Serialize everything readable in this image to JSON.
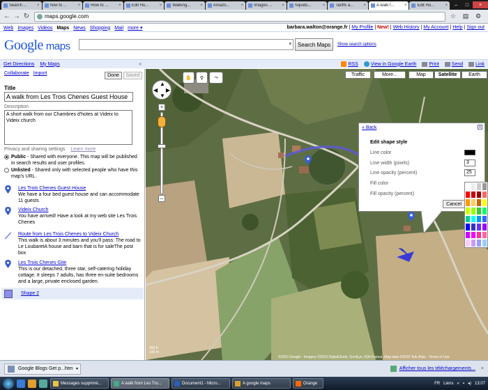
{
  "browser": {
    "tabs": [
      {
        "label": "Search ..."
      },
      {
        "label": "how to ..."
      },
      {
        "label": "How to ..."
      },
      {
        "label": "Edit Hu..."
      },
      {
        "label": "Walking..."
      },
      {
        "label": "Amazo..."
      },
      {
        "label": "Images ..."
      },
      {
        "label": "Squido..."
      },
      {
        "label": "Tariffs a..."
      },
      {
        "label": "A walk f..."
      },
      {
        "label": "Edit Hu..."
      }
    ],
    "url": "maps.google.com"
  },
  "gbar": {
    "links": [
      "Web",
      "Images",
      "Videos",
      "Maps",
      "News",
      "Shopping",
      "Mail",
      "more ▾"
    ],
    "user": "barbara.walton@orange.fr",
    "profile": "My Profile",
    "new_label": "New!",
    "history": "Web History",
    "account": "My Account",
    "help": "Help",
    "signout": "Sign out"
  },
  "header": {
    "logo_google": "Google",
    "logo_maps": "maps",
    "search_button": "Search Maps",
    "search_options": "Show search options"
  },
  "subbar": {
    "get_directions": "Get Directions",
    "my_maps": "My Maps",
    "collapse": "«",
    "rss": "RSS",
    "earth": "View in Google Earth",
    "print": "Print",
    "send": "Send",
    "link": "Link"
  },
  "panel": {
    "collaborate": "Collaborate",
    "import": "Import",
    "done": "Done",
    "saved": "Saved",
    "title_label": "Title",
    "title_value": "A walk from Les Trois Chenes Guest House",
    "description_label": "Description",
    "description_value": "A short walk from our Chambres d'hotes at Videix to Videix church",
    "privacy_label": "Privacy and sharing settings",
    "learn_more": "Learn more",
    "public_title": "Public",
    "public_text": " - Shared with everyone. This map will be published in search results and user profiles.",
    "unlisted_title": "Unlisted",
    "unlisted_text": " - Shared only with selected people who have this map's URL.",
    "features": [
      {
        "title": "Les Trois Chenes Guest House",
        "text": "We have a four bed guest house and can accommodate 11 guests"
      },
      {
        "title": "Videix Church",
        "text": "You have arrived! Have a look at my web site Les Trois Chenes"
      },
      {
        "title": "Route from Les Trois Chenes to Videix Church",
        "text": "This walk is about 3 minutes and you'll pass: The road to Le LoubaretA house and barn that is for saleThe post box"
      },
      {
        "title": "Les Trois Chenes Gite",
        "text": "This is our detached, three star, self-catering holiday cottage. It sleeps 7 adults, has three en-suite bedrooms and a large, private enclosed garden."
      }
    ],
    "shape": "Shape 2"
  },
  "map": {
    "buttons": {
      "traffic": "Traffic",
      "more": "More...",
      "map": "Map",
      "satellite": "Satellite",
      "earth": "Earth"
    },
    "popup": {
      "back": "« Back",
      "close": "x",
      "heading": "Edit shape style",
      "line_color": "Line color",
      "line_width": "Line width (pixels)",
      "line_width_value": "3",
      "line_opacity": "Line opacity (percent)",
      "line_opacity_value": "25",
      "fill_color": "Fill color",
      "fill_opacity": "Fill opacity (percent)",
      "cancel": "Cancel"
    },
    "copyright": "©2010 Google - Imagery ©2010 DigitalGlobe, GeoEye, IGN-France, Map data ©2010 Tele Atlas - Terms of Use",
    "scale_top": "200 ft",
    "scale_bottom": "100 m",
    "accent": "#5b5bd6"
  },
  "downloads": {
    "item": "Google Blogs Get p...htm",
    "show_all": "Afficher tous les téléchargements..."
  },
  "taskbar": {
    "tasks": [
      "Messages supprimé...",
      "A walk from Les Tro...",
      "Document1 - Micro...",
      "A google maps",
      "Orange"
    ],
    "lang": "FR",
    "links": "Liens",
    "time": "13:07"
  }
}
